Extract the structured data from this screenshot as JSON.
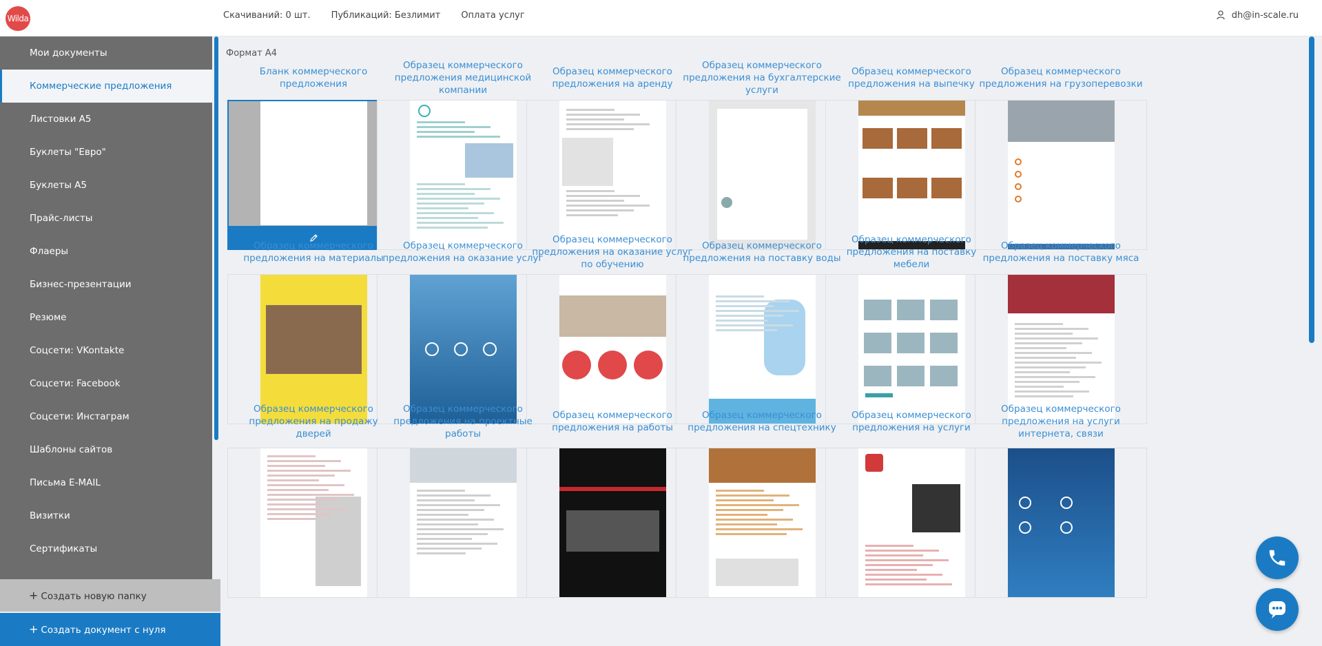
{
  "header": {
    "logo_text": "Wilda",
    "downloads": "Скачиваний: 0 шт.",
    "publications": "Публикаций: Безлимит",
    "payment_link": "Оплата услуг",
    "user_email": "dh@in-scale.ru"
  },
  "sidebar": {
    "items": [
      {
        "label": "Мои документы",
        "active": false
      },
      {
        "label": "Коммерческие предложения",
        "active": true
      },
      {
        "label": "Листовки А5",
        "active": false
      },
      {
        "label": "Буклеты \"Евро\"",
        "active": false
      },
      {
        "label": "Буклеты А5",
        "active": false
      },
      {
        "label": "Прайс-листы",
        "active": false
      },
      {
        "label": "Флаеры",
        "active": false
      },
      {
        "label": "Бизнес-презентации",
        "active": false
      },
      {
        "label": "Резюме",
        "active": false
      },
      {
        "label": "Соцсети: VKontakte",
        "active": false
      },
      {
        "label": "Соцсети: Facebook",
        "active": false
      },
      {
        "label": "Соцсети: Инстаграм",
        "active": false
      },
      {
        "label": "Шаблоны сайтов",
        "active": false
      },
      {
        "label": "Письма E-MAIL",
        "active": false
      },
      {
        "label": "Визитки",
        "active": false
      },
      {
        "label": "Сертификаты",
        "active": false
      }
    ],
    "create_folder": "Создать новую папку",
    "create_document": "Создать документ с нуля"
  },
  "main": {
    "section_title": "Формат А4",
    "templates": [
      {
        "title": "Бланк коммерческого предложения",
        "style": "blank"
      },
      {
        "title": "Образец коммерческого предложения медицинской компании",
        "style": "medical"
      },
      {
        "title": "Образец коммерческого предложения на аренду",
        "style": "rent"
      },
      {
        "title": "Образец коммерческого предложения на бухгалтерские услуги",
        "style": "accounting"
      },
      {
        "title": "Образец коммерческого предложения на выпечку",
        "style": "bakery"
      },
      {
        "title": "Образец коммерческого предложения на грузоперевозки",
        "style": "trucks"
      },
      {
        "title": "Образец коммерческого предложения на материалы",
        "style": "materials"
      },
      {
        "title": "Образец коммерческого предложения на оказание услуг",
        "style": "services"
      },
      {
        "title": "Образец коммерческого предложения на оказание услуг по обучению",
        "style": "training"
      },
      {
        "title": "Образец коммерческого предложения на поставку воды",
        "style": "water"
      },
      {
        "title": "Образец коммерческого предложения на поставку мебели",
        "style": "furniture"
      },
      {
        "title": "Образец коммерческого предложения на поставку мяса",
        "style": "meat"
      },
      {
        "title": "Образец коммерческого предложения на продажу дверей",
        "style": "doors"
      },
      {
        "title": "Образец коммерческого предложения на проектные работы",
        "style": "project"
      },
      {
        "title": "Образец коммерческого предложения на работы",
        "style": "works"
      },
      {
        "title": "Образец коммерческого предложения на спецтехнику",
        "style": "machinery"
      },
      {
        "title": "Образец коммерческого предложения на услуги",
        "style": "uslugi"
      },
      {
        "title": "Образец коммерческого предложения на услуги интернета, связи",
        "style": "internet"
      }
    ]
  },
  "colors": {
    "accent": "#1a7bc4",
    "sidebar_bg": "#6d6d6d",
    "title_link": "#3a8ed4",
    "logo": "#e24a4a"
  },
  "icons": {
    "user": "user-icon",
    "edit": "pencil-icon",
    "phone": "phone-icon",
    "chat": "chat-icon",
    "plus": "plus-icon"
  }
}
